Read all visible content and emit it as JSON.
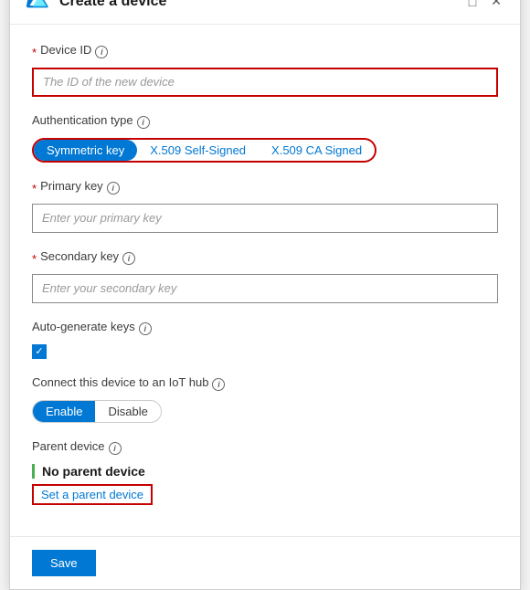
{
  "dialog": {
    "title": "Create a device",
    "header_controls": {
      "minimize_label": "□",
      "close_label": "✕"
    }
  },
  "form": {
    "device_id": {
      "label": "Device ID",
      "placeholder": "The ID of the new device",
      "value": ""
    },
    "auth_type": {
      "label": "Authentication type",
      "options": [
        "Symmetric key",
        "X.509 Self-Signed",
        "X.509 CA Signed"
      ],
      "active": "Symmetric key"
    },
    "primary_key": {
      "label": "Primary key",
      "placeholder": "Enter your primary key",
      "value": ""
    },
    "secondary_key": {
      "label": "Secondary key",
      "placeholder": "Enter your secondary key",
      "value": ""
    },
    "auto_generate": {
      "label": "Auto-generate keys",
      "checked": true
    },
    "iot_hub": {
      "label": "Connect this device to an IoT hub",
      "options": [
        "Enable",
        "Disable"
      ],
      "active": "Enable"
    },
    "parent_device": {
      "label": "Parent device",
      "no_parent_text": "No parent device",
      "set_parent_label": "Set a parent device"
    }
  },
  "footer": {
    "save_label": "Save"
  },
  "icons": {
    "info": "i",
    "check": "✓"
  }
}
